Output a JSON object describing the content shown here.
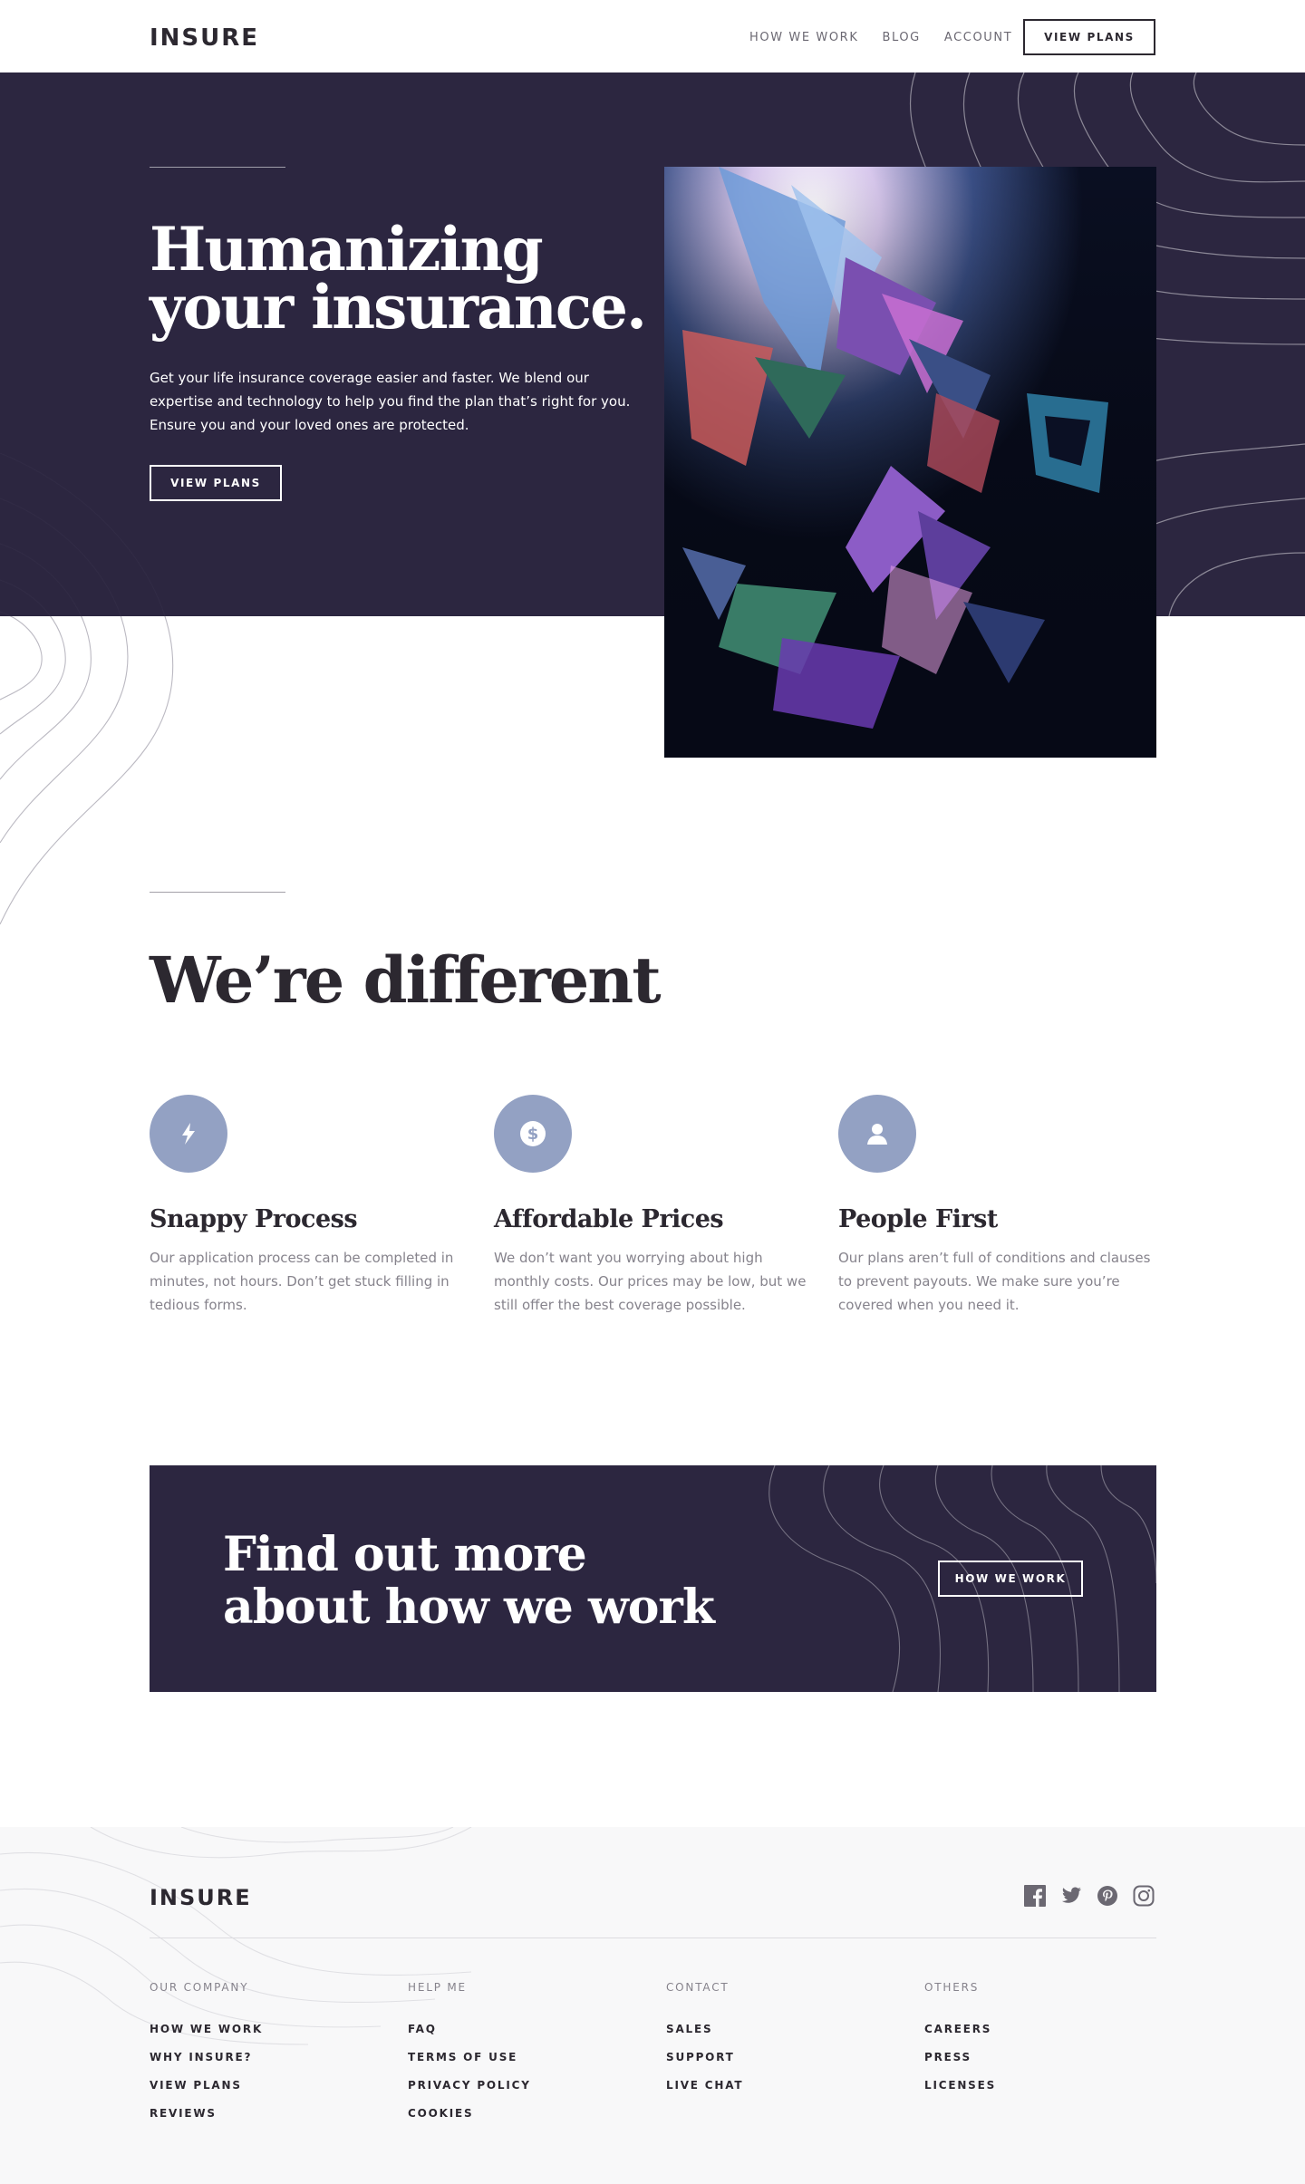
{
  "nav": {
    "logo": "INSURE",
    "links": [
      "HOW WE WORK",
      "BLOG",
      "ACCOUNT"
    ],
    "cta": "VIEW PLANS"
  },
  "hero": {
    "title_line1": "Humanizing",
    "title_line2": "your insurance.",
    "text": "Get your life insurance coverage easier and faster. We blend our expertise and technology to help you find the plan that’s right for you. Ensure you and your loved ones are protected.",
    "cta": "VIEW PLANS"
  },
  "different": {
    "title": "We’re different",
    "features": [
      {
        "icon": "lightning-icon",
        "title": "Snappy Process",
        "text": "Our application process can be completed in minutes, not hours. Don’t get stuck filling in tedious forms."
      },
      {
        "icon": "dollar-icon",
        "title": "Affordable Prices",
        "text": "We don’t want you worrying about high monthly costs. Our prices may be low, but we still offer the best coverage possible."
      },
      {
        "icon": "person-icon",
        "title": "People First",
        "text": "Our plans aren’t full of conditions and clauses to prevent payouts. We make sure you’re covered when you need it."
      }
    ]
  },
  "cta_section": {
    "title_line1": "Find out more",
    "title_line2": "about how we work",
    "button": "HOW WE WORK"
  },
  "footer": {
    "logo": "INSURE",
    "social": [
      "facebook-icon",
      "twitter-icon",
      "pinterest-icon",
      "instagram-icon"
    ],
    "columns": [
      {
        "heading": "OUR COMPANY",
        "items": [
          "HOW WE WORK",
          "WHY INSURE?",
          "VIEW PLANS",
          "REVIEWS"
        ]
      },
      {
        "heading": "HELP ME",
        "items": [
          "FAQ",
          "TERMS OF USE",
          "PRIVACY POLICY",
          "COOKIES"
        ]
      },
      {
        "heading": "CONTACT",
        "items": [
          "SALES",
          "SUPPORT",
          "LIVE CHAT"
        ]
      },
      {
        "heading": "OTHERS",
        "items": [
          "CAREERS",
          "PRESS",
          "LICENSES"
        ]
      }
    ]
  },
  "colors": {
    "dark_violet": "#2c2640",
    "icon_circle": "#93a1c3",
    "footer_bg": "#f8f8f9"
  }
}
